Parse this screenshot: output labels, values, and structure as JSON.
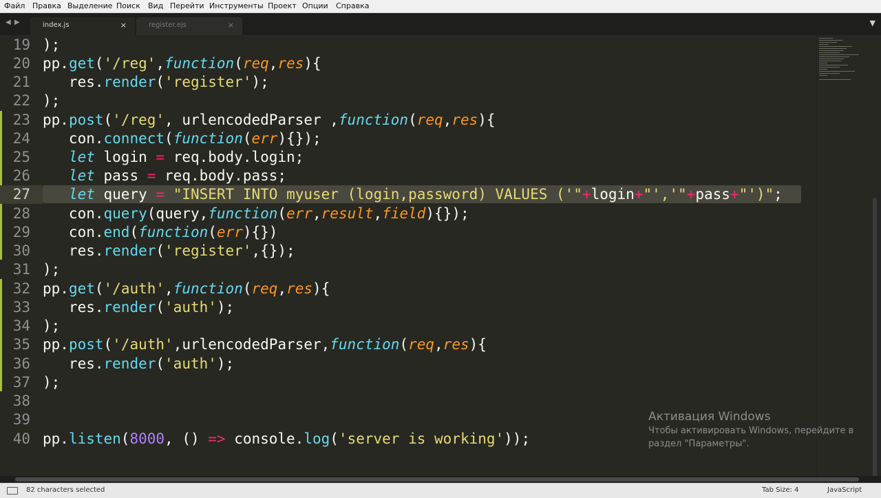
{
  "menu": [
    "Файл",
    "Правка",
    "Выделение",
    "Поиск",
    "Вид",
    "Перейти",
    "Инструменты",
    "Проект",
    "Опции",
    "Справка"
  ],
  "tabs": [
    {
      "label": "index.js",
      "active": true
    },
    {
      "label": "register.ejs",
      "active": false
    }
  ],
  "tab_arrows": "◀ ▶",
  "tab_close_glyph": "×",
  "tab_menu_glyph": "▼",
  "editor": {
    "line_numbers": [
      "19",
      "20",
      "21",
      "22",
      "23",
      "24",
      "25",
      "26",
      "27",
      "28",
      "29",
      "30",
      "31",
      "32",
      "33",
      "34",
      "35",
      "36",
      "37",
      "38",
      "39",
      "40"
    ],
    "current_line": "27"
  },
  "status": {
    "selection": "82 characters selected",
    "tab_size": "Tab Size: 4",
    "syntax": "JavaScript"
  },
  "activation": {
    "title": "Активация Windows",
    "line1": "Чтобы активировать Windows, перейдите в",
    "line2": "раздел \"Параметры\"."
  },
  "colors": {
    "background": "#272822",
    "keyword": "#66d9ef",
    "string": "#e6db74",
    "operator": "#f92672",
    "number": "#ae81ff",
    "argument": "#fd971f",
    "gutter_modified": "#a6c23a",
    "selection": "#49483e"
  }
}
